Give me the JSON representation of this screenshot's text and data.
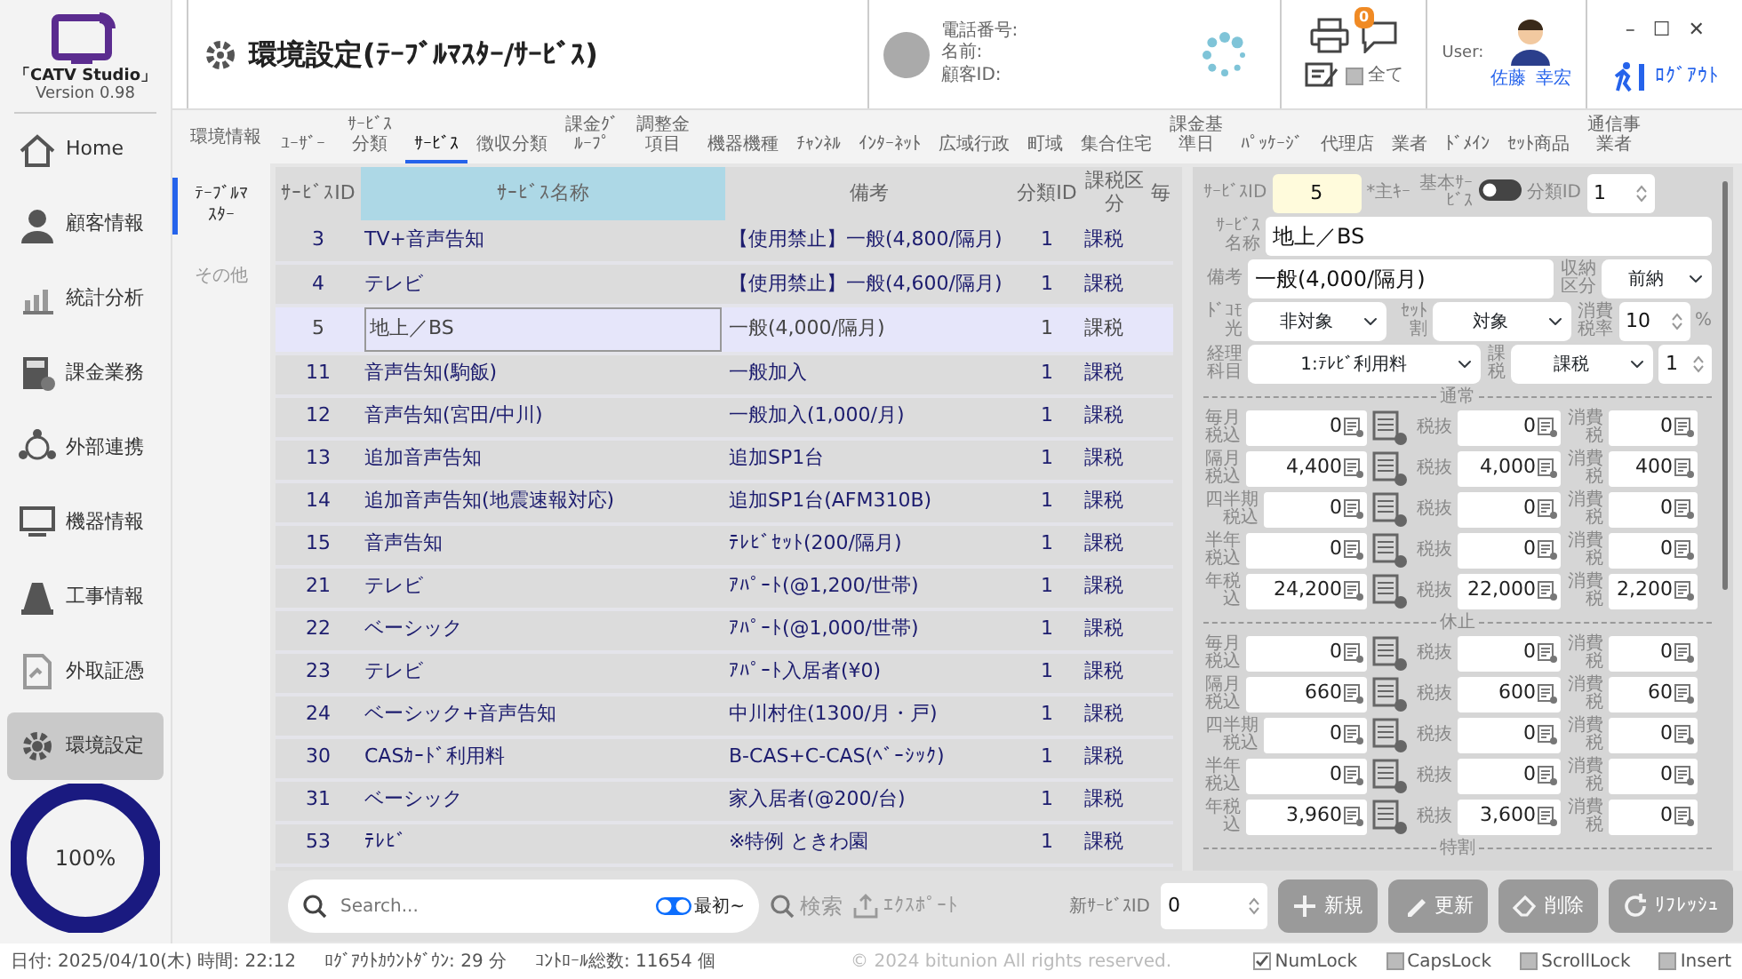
{
  "app": {
    "name": "「CATV Studio」",
    "version": "Version 0.98"
  },
  "sidebar": {
    "items": [
      {
        "label": "Home",
        "selected": false
      },
      {
        "label": "顧客情報",
        "selected": false
      },
      {
        "label": "統計分析",
        "selected": false
      },
      {
        "label": "課金業務",
        "selected": false
      },
      {
        "label": "外部連携",
        "selected": false
      },
      {
        "label": "機器情報",
        "selected": false
      },
      {
        "label": "工事情報",
        "selected": false
      },
      {
        "label": "外取証憑",
        "selected": false
      },
      {
        "label": "環境設定",
        "selected": true
      }
    ],
    "progress": {
      "level": 1,
      "reading": "100%"
    }
  },
  "header": {
    "title": "環境設定(ﾃｰﾌﾞﾙﾏｽﾀｰ/ｻｰﾋﾞｽ)",
    "customer_fields": [
      "電話番号:",
      "名前:",
      "顧客ID:"
    ],
    "notification_count": "0",
    "filter": {
      "label": "全て",
      "checked": false
    },
    "user_label": "User:",
    "user_name": [
      "佐藤",
      "幸宏"
    ],
    "window_controls": [
      "–",
      "☐",
      "✕"
    ],
    "logout": "ﾛｸﾞｱｳﾄ"
  },
  "tabs": {
    "section_label": "環境情報",
    "items": [
      {
        "label": "ﾕｰｻﾞｰ",
        "selected": false
      },
      {
        "label": "ｻｰﾋﾞｽ分類",
        "selected": false
      },
      {
        "label": "ｻｰﾋﾞｽ",
        "selected": true
      },
      {
        "label": "徴収分類",
        "selected": false
      },
      {
        "label": "課金ｸﾞﾙｰﾌﾟ",
        "selected": false
      },
      {
        "label": "調整金項目",
        "selected": false
      },
      {
        "label": "機器機種",
        "selected": false
      },
      {
        "label": "ﾁｬﾝﾈﾙ",
        "selected": false
      },
      {
        "label": "ｲﾝﾀｰﾈｯﾄ",
        "selected": false
      },
      {
        "label": "広域行政",
        "selected": false
      },
      {
        "label": "町域",
        "selected": false
      },
      {
        "label": "集合住宅",
        "selected": false
      },
      {
        "label": "課金基準日",
        "selected": false
      },
      {
        "label": "ﾊﾟｯｹｰｼﾞ",
        "selected": false
      },
      {
        "label": "代理店",
        "selected": false
      },
      {
        "label": "業者",
        "selected": false
      },
      {
        "label": "ﾄﾞﾒｲﾝ",
        "selected": false
      },
      {
        "label": "ｾｯﾄ商品",
        "selected": false
      },
      {
        "label": "通信事業者",
        "selected": false
      }
    ]
  },
  "subnav": [
    {
      "label": "ﾃｰﾌﾞﾙﾏｽﾀｰ",
      "selected": true
    },
    {
      "label": "その他",
      "selected": false
    }
  ],
  "table": {
    "columns": [
      {
        "label": "ｻｰﾋﾞｽID",
        "sorted": false
      },
      {
        "label": "ｻｰﾋﾞｽ名称",
        "sorted": true
      },
      {
        "label": "備考",
        "sorted": false
      },
      {
        "label": "分類ID",
        "sorted": false
      },
      {
        "label": "課税区分",
        "sorted": false
      },
      {
        "label": "毎",
        "sorted": false
      }
    ],
    "rows": [
      {
        "id": "3",
        "name": "TV+音声告知",
        "note": "【使用禁止】一般(4,800/隔月)",
        "category_id": "1",
        "tax": "課税",
        "selected": false
      },
      {
        "id": "4",
        "name": "テレビ",
        "note": "【使用禁止】一般(4,600/隔月)",
        "category_id": "1",
        "tax": "課税",
        "selected": false
      },
      {
        "id": "5",
        "name": "地上／BS",
        "note": "一般(4,000/隔月)",
        "category_id": "1",
        "tax": "課税",
        "selected": true
      },
      {
        "id": "11",
        "name": "音声告知(駒飯)",
        "note": "一般加入",
        "category_id": "1",
        "tax": "課税",
        "selected": false
      },
      {
        "id": "12",
        "name": "音声告知(宮田/中川)",
        "note": "一般加入(1,000/月)",
        "category_id": "1",
        "tax": "課税",
        "selected": false
      },
      {
        "id": "13",
        "name": "追加音声告知",
        "note": "追加SP1台",
        "category_id": "1",
        "tax": "課税",
        "selected": false
      },
      {
        "id": "14",
        "name": "追加音声告知(地震速報対応)",
        "note": "追加SP1台(AFM310B)",
        "category_id": "1",
        "tax": "課税",
        "selected": false
      },
      {
        "id": "15",
        "name": "音声告知",
        "note": "ﾃﾚﾋﾞｾｯﾄ(200/隔月)",
        "category_id": "1",
        "tax": "課税",
        "selected": false
      },
      {
        "id": "21",
        "name": "テレビ",
        "note": "ｱﾊﾟｰﾄ(@1,200/世帯)",
        "category_id": "1",
        "tax": "課税",
        "selected": false
      },
      {
        "id": "22",
        "name": "ベーシック",
        "note": "ｱﾊﾟｰﾄ(@1,000/世帯)",
        "category_id": "1",
        "tax": "課税",
        "selected": false
      },
      {
        "id": "23",
        "name": "テレビ",
        "note": "ｱﾊﾟｰﾄ入居者(¥0)",
        "category_id": "1",
        "tax": "課税",
        "selected": false
      },
      {
        "id": "24",
        "name": "ベーシック+音声告知",
        "note": "中川村住(1300/月・戸)",
        "category_id": "1",
        "tax": "課税",
        "selected": false
      },
      {
        "id": "30",
        "name": "CASｶｰﾄﾞ利用料",
        "note": "B-CAS+C-CAS(ﾍﾞｰｼｯｸ)",
        "category_id": "1",
        "tax": "課税",
        "selected": false
      },
      {
        "id": "31",
        "name": "ベーシック",
        "note": "家入居者(@200/台)",
        "category_id": "1",
        "tax": "課税",
        "selected": false
      },
      {
        "id": "53",
        "name": "ﾃﾚﾋﾞ",
        "note": "※特例 ときわ園",
        "category_id": "1",
        "tax": "課税",
        "selected": false
      }
    ]
  },
  "form": {
    "service_id": {
      "label": "ｻｰﾋﾞｽID",
      "value": "5"
    },
    "primary_key_note": "*主ｷｰ",
    "basic_service": {
      "label": "基本ｻｰﾋﾞｽ",
      "on": false
    },
    "category_id": {
      "label": "分類ID",
      "value": "1"
    },
    "service_name": {
      "label": "ｻｰﾋﾞｽ名称",
      "value": "地上／BS"
    },
    "note": {
      "label": "備考",
      "value": "一般(4,000/隔月)"
    },
    "storage_type": {
      "label": "収納区分",
      "value": "前納"
    },
    "docomo": {
      "label": "ﾄﾞｺﾓ光",
      "value": "非対象"
    },
    "set_discount": {
      "label": "ｾｯﾄ割",
      "value": "対象"
    },
    "tax_rate": {
      "label": "消費税率",
      "value": "10",
      "unit": "%"
    },
    "account": {
      "label": "経理科目",
      "value": "1:ﾃﾚﾋﾞ利用料"
    },
    "taxation": {
      "label": "課税",
      "value": "課税",
      "number": "1"
    },
    "sections": [
      {
        "title": "通常",
        "rows": [
          {
            "label": "毎月税込",
            "incl": "0",
            "excl_label": "税抜",
            "excl": "0",
            "tax_label": "消費税",
            "tax": "0"
          },
          {
            "label": "隔月税込",
            "incl": "4,400",
            "excl_label": "税抜",
            "excl": "4,000",
            "tax_label": "消費税",
            "tax": "400"
          },
          {
            "label": "四半期税込",
            "incl": "0",
            "excl_label": "税抜",
            "excl": "0",
            "tax_label": "消費税",
            "tax": "0"
          },
          {
            "label": "半年税込",
            "incl": "0",
            "excl_label": "税抜",
            "excl": "0",
            "tax_label": "消費税",
            "tax": "0"
          },
          {
            "label": "年税込",
            "incl": "24,200",
            "excl_label": "税抜",
            "excl": "22,000",
            "tax_label": "消費税",
            "tax": "2,200"
          }
        ]
      },
      {
        "title": "休止",
        "rows": [
          {
            "label": "毎月税込",
            "incl": "0",
            "excl_label": "税抜",
            "excl": "0",
            "tax_label": "消費税",
            "tax": "0"
          },
          {
            "label": "隔月税込",
            "incl": "660",
            "excl_label": "税抜",
            "excl": "600",
            "tax_label": "消費税",
            "tax": "60"
          },
          {
            "label": "四半期税込",
            "incl": "0",
            "excl_label": "税抜",
            "excl": "0",
            "tax_label": "消費税",
            "tax": "0"
          },
          {
            "label": "半年税込",
            "incl": "0",
            "excl_label": "税抜",
            "excl": "0",
            "tax_label": "消費税",
            "tax": "0"
          },
          {
            "label": "年税込",
            "incl": "3,960",
            "excl_label": "税抜",
            "excl": "3,600",
            "tax_label": "消費税",
            "tax": "0"
          }
        ]
      },
      {
        "title": "特割"
      }
    ]
  },
  "toolbar": {
    "search": {
      "placeholder": "Search..."
    },
    "first_toggle": {
      "label": "最初~",
      "on": true
    },
    "search_button": "検索",
    "export_button": "ｴｸｽﾎﾟｰﾄ",
    "new_id": {
      "label": "新ｻｰﾋﾞｽID",
      "value": "0"
    },
    "actions": [
      {
        "label": "新規",
        "disabled": true
      },
      {
        "label": "更新",
        "disabled": true
      },
      {
        "label": "削除",
        "disabled": true
      },
      {
        "label": "ﾘﾌﾚｯｼｭ",
        "disabled": true
      }
    ]
  },
  "status_bar": {
    "datetime": "日付: 2025/04/10(木) 時間: 22:12",
    "countdown": "ﾛｸﾞｱｳﾄｶｳﾝﾄﾀﾞｳﾝ: 29 分",
    "control_count": "ｺﾝﾄﾛｰﾙ総数: 11654 個",
    "copyright": "© 2024 bitunion All rights reserved.",
    "locks": [
      {
        "label": "NumLock",
        "on": true
      },
      {
        "label": "CapsLock",
        "on": false
      },
      {
        "label": "ScrollLock",
        "on": false
      },
      {
        "label": "Insert",
        "on": false
      }
    ]
  }
}
